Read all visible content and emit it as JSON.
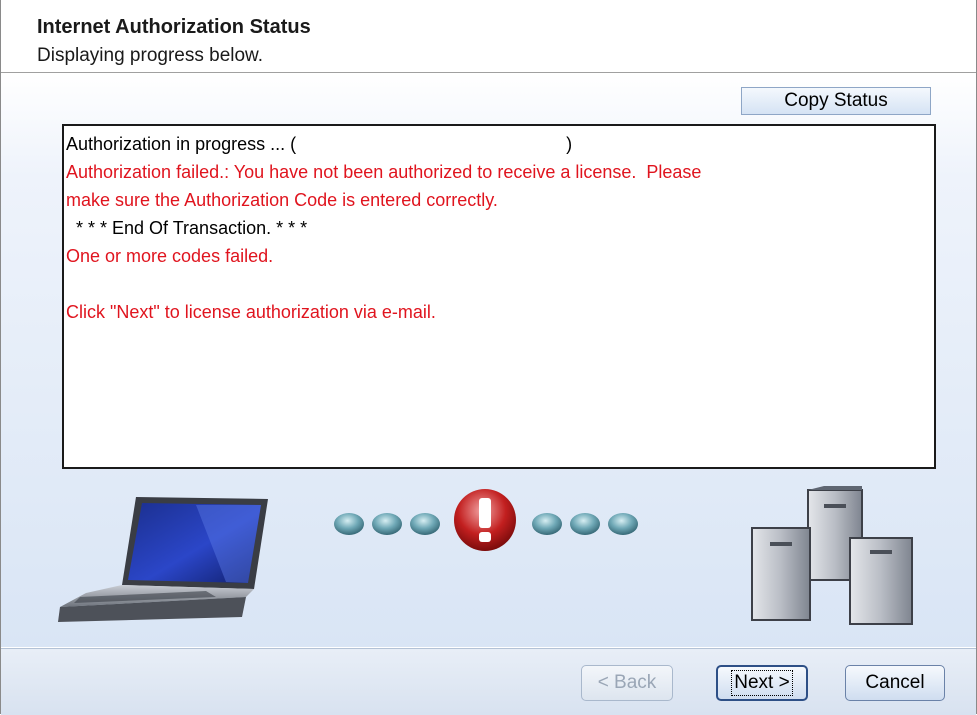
{
  "header": {
    "title": "Internet Authorization Status",
    "subtitle": "Displaying progress below."
  },
  "toolbar": {
    "copy_status_label": "Copy Status"
  },
  "status": {
    "line1_prefix": "Authorization in progress ... (",
    "line1_suffix": ")",
    "line2": "Authorization failed.: You have not been authorized to receive a license.  Please",
    "line3": "make sure the Authorization Code is entered correctly.",
    "line4": "  * * * End Of Transaction. * * *",
    "line5": "One or more codes failed.",
    "line6": "",
    "line7": "Click \"Next\" to license authorization via e-mail."
  },
  "footer": {
    "back_label": "< Back",
    "next_label": "Next >",
    "cancel_label": "Cancel"
  },
  "colors": {
    "error_text": "#e0141e",
    "accent": "#2d4f86"
  },
  "icons": {
    "laptop": "laptop-icon",
    "progress": "progress-dots-with-error",
    "error": "exclamation-icon",
    "servers": "servers-icon"
  },
  "progress": {
    "steps_before_error": 3,
    "steps_after_error": 3,
    "state": "error"
  }
}
